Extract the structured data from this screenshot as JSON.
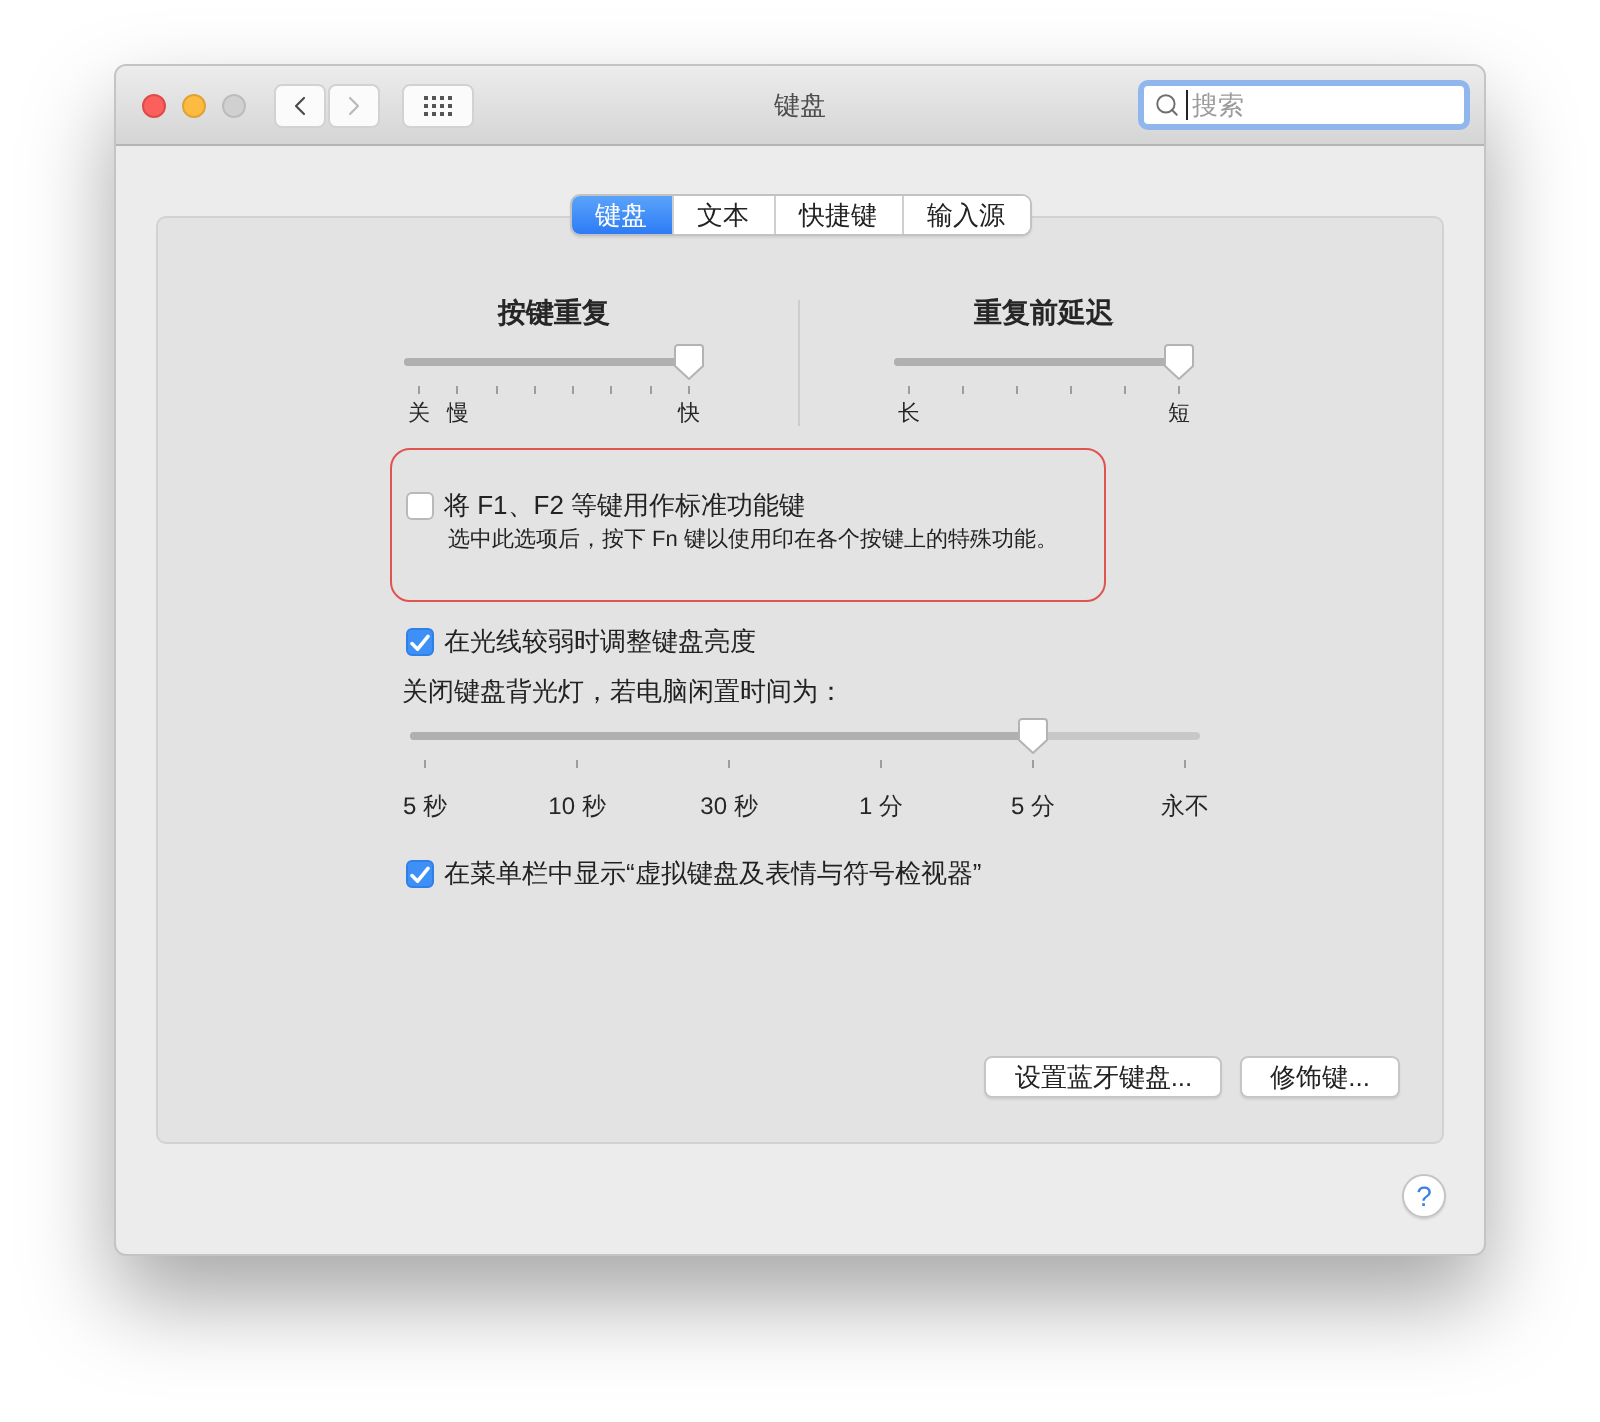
{
  "window": {
    "title": "键盘",
    "traffic_lights": [
      {
        "kind": "close",
        "disabled": false
      },
      {
        "kind": "minimize",
        "disabled": false
      },
      {
        "kind": "zoom",
        "disabled": true
      }
    ],
    "navigation": [
      {
        "kind": "back",
        "disabled": false
      },
      {
        "kind": "forward",
        "disabled": true
      }
    ],
    "search": {
      "placeholder": "搜索",
      "focused": true
    }
  },
  "tabs": [
    {
      "label": "键盘",
      "selected": true
    },
    {
      "label": "文本",
      "selected": false
    },
    {
      "label": "快捷键",
      "selected": false
    },
    {
      "label": "输入源",
      "selected": false
    }
  ],
  "repeat_sliders": [
    {
      "kind": "key_repeat",
      "title": "按键重复",
      "level": 1,
      "tick_labels": [
        "关",
        "慢",
        "快"
      ]
    },
    {
      "kind": "repeat_delay",
      "title": "重复前延迟",
      "level": 1,
      "tick_labels": [
        "长",
        "短"
      ]
    }
  ],
  "fn_option": {
    "label": "将 F1、F2 等键用作标准功能键",
    "description": "选中此选项后，按下 Fn 键以使用印在各个按键上的特殊功能。",
    "checked": false,
    "highlighted": true
  },
  "brightness_option": {
    "label": "在光线较弱时调整键盘亮度",
    "checked": true
  },
  "backlight": {
    "label": "关闭键盘背光灯，若电脑闲置时间为：",
    "level": 0.8,
    "tick_labels": [
      "5 秒",
      "10 秒",
      "30 秒",
      "1 分",
      "5 分",
      "永不"
    ]
  },
  "menu_option": {
    "label": "在菜单栏中显示“虚拟键盘及表情与符号检视器”",
    "checked": true
  },
  "buttons": [
    {
      "label": "设置蓝牙键盘..."
    },
    {
      "label": "修饰键..."
    }
  ],
  "help": {
    "label": "?"
  }
}
